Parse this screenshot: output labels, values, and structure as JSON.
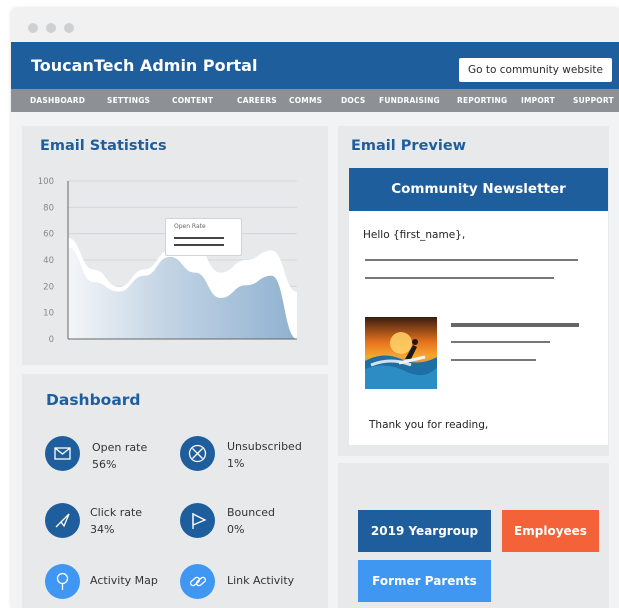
{
  "header": {
    "title": "ToucanTech Admin Portal",
    "community_button": "Go to community website"
  },
  "nav": {
    "items": [
      "DASHBOARD",
      "SETTINGS",
      "CONTENT",
      "CAREERS",
      "COMMS",
      "DOCS",
      "FUNDRAISING",
      "REPORTING",
      "IMPORT",
      "SUPPORT"
    ]
  },
  "email_statistics": {
    "title": "Email Statistics",
    "tooltip_label": "Open Rate",
    "chart_data": {
      "type": "area",
      "title": "Email Statistics",
      "y_ticks": [
        "100",
        "80",
        "60",
        "40",
        "20",
        "10",
        "0"
      ],
      "ylim": [
        0,
        100
      ],
      "grid": true,
      "series": [
        {
          "x": [
            0,
            1,
            2,
            3,
            4,
            5,
            6,
            7,
            8,
            9
          ],
          "values": [
            64,
            44,
            33,
            44,
            56,
            58,
            42,
            50,
            56,
            30
          ],
          "color": "#ffffff"
        },
        {
          "x": [
            0,
            1,
            2,
            3,
            4,
            5,
            6,
            7,
            8,
            9
          ],
          "values": [
            58,
            36,
            30,
            40,
            52,
            42,
            26,
            34,
            40,
            0
          ],
          "color": "#9ab9d6"
        }
      ],
      "highlighted_point": {
        "x": 4,
        "y": 52,
        "label": "Open Rate"
      }
    }
  },
  "email_preview": {
    "title": "Email Preview",
    "newsletter_title": "Community Newsletter",
    "greeting": "Hello {first_name},",
    "closing": "Thank you for reading,"
  },
  "dashboard": {
    "title": "Dashboard",
    "stats": [
      {
        "label": "Open rate",
        "value": "56%",
        "icon": "envelope-icon"
      },
      {
        "label": "Unsubscribed",
        "value": "1%",
        "icon": "cross-icon"
      },
      {
        "label": "Click rate",
        "value": "34%",
        "icon": "pointer-icon"
      },
      {
        "label": "Bounced",
        "value": "0%",
        "icon": "flag-icon"
      },
      {
        "label": "Activity Map",
        "icon": "map-pin-icon"
      },
      {
        "label": "Link Activity",
        "icon": "link-icon"
      }
    ]
  },
  "groups": {
    "tags": [
      {
        "label": "2019 Yeargroup",
        "color": "#1f5e9c"
      },
      {
        "label": "Employees",
        "color": "#f4623a"
      },
      {
        "label": "Former Parents",
        "color": "#3f97f2"
      }
    ]
  }
}
